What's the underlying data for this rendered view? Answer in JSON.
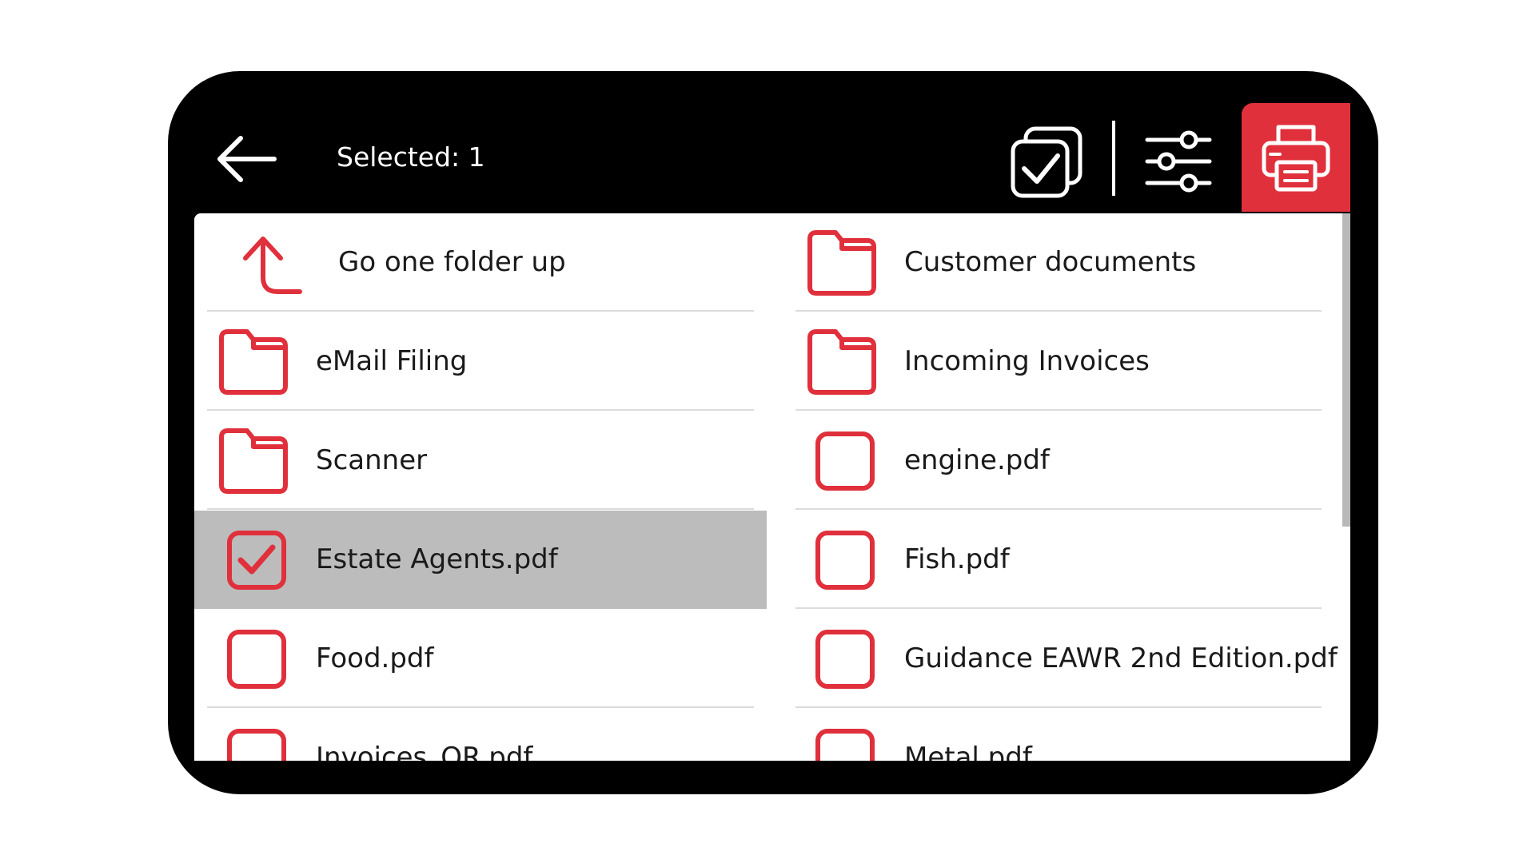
{
  "header": {
    "title": "Selected: 1"
  },
  "accent_color": "#e0303c",
  "left_column": [
    {
      "label": "Go one folder up",
      "icon": "folder-up-icon",
      "type": "up"
    },
    {
      "label": "eMail Filing",
      "icon": "folder-icon",
      "type": "folder"
    },
    {
      "label": "Scanner",
      "icon": "folder-icon",
      "type": "folder"
    },
    {
      "label": "Estate Agents.pdf",
      "icon": "checkbox-checked-icon",
      "type": "file",
      "selected": true
    },
    {
      "label": "Food.pdf",
      "icon": "checkbox-icon",
      "type": "file"
    },
    {
      "label": "Invoices_QR.pdf",
      "icon": "checkbox-icon",
      "type": "file"
    }
  ],
  "right_column": [
    {
      "label": "Customer documents",
      "icon": "folder-icon",
      "type": "folder"
    },
    {
      "label": "Incoming Invoices",
      "icon": "folder-icon",
      "type": "folder"
    },
    {
      "label": "engine.pdf",
      "icon": "checkbox-icon",
      "type": "file"
    },
    {
      "label": "Fish.pdf",
      "icon": "checkbox-icon",
      "type": "file"
    },
    {
      "label": "Guidance EAWR 2nd Edition.pdf",
      "icon": "checkbox-icon",
      "type": "file"
    },
    {
      "label": "Metal.pdf",
      "icon": "checkbox-icon",
      "type": "file"
    }
  ]
}
